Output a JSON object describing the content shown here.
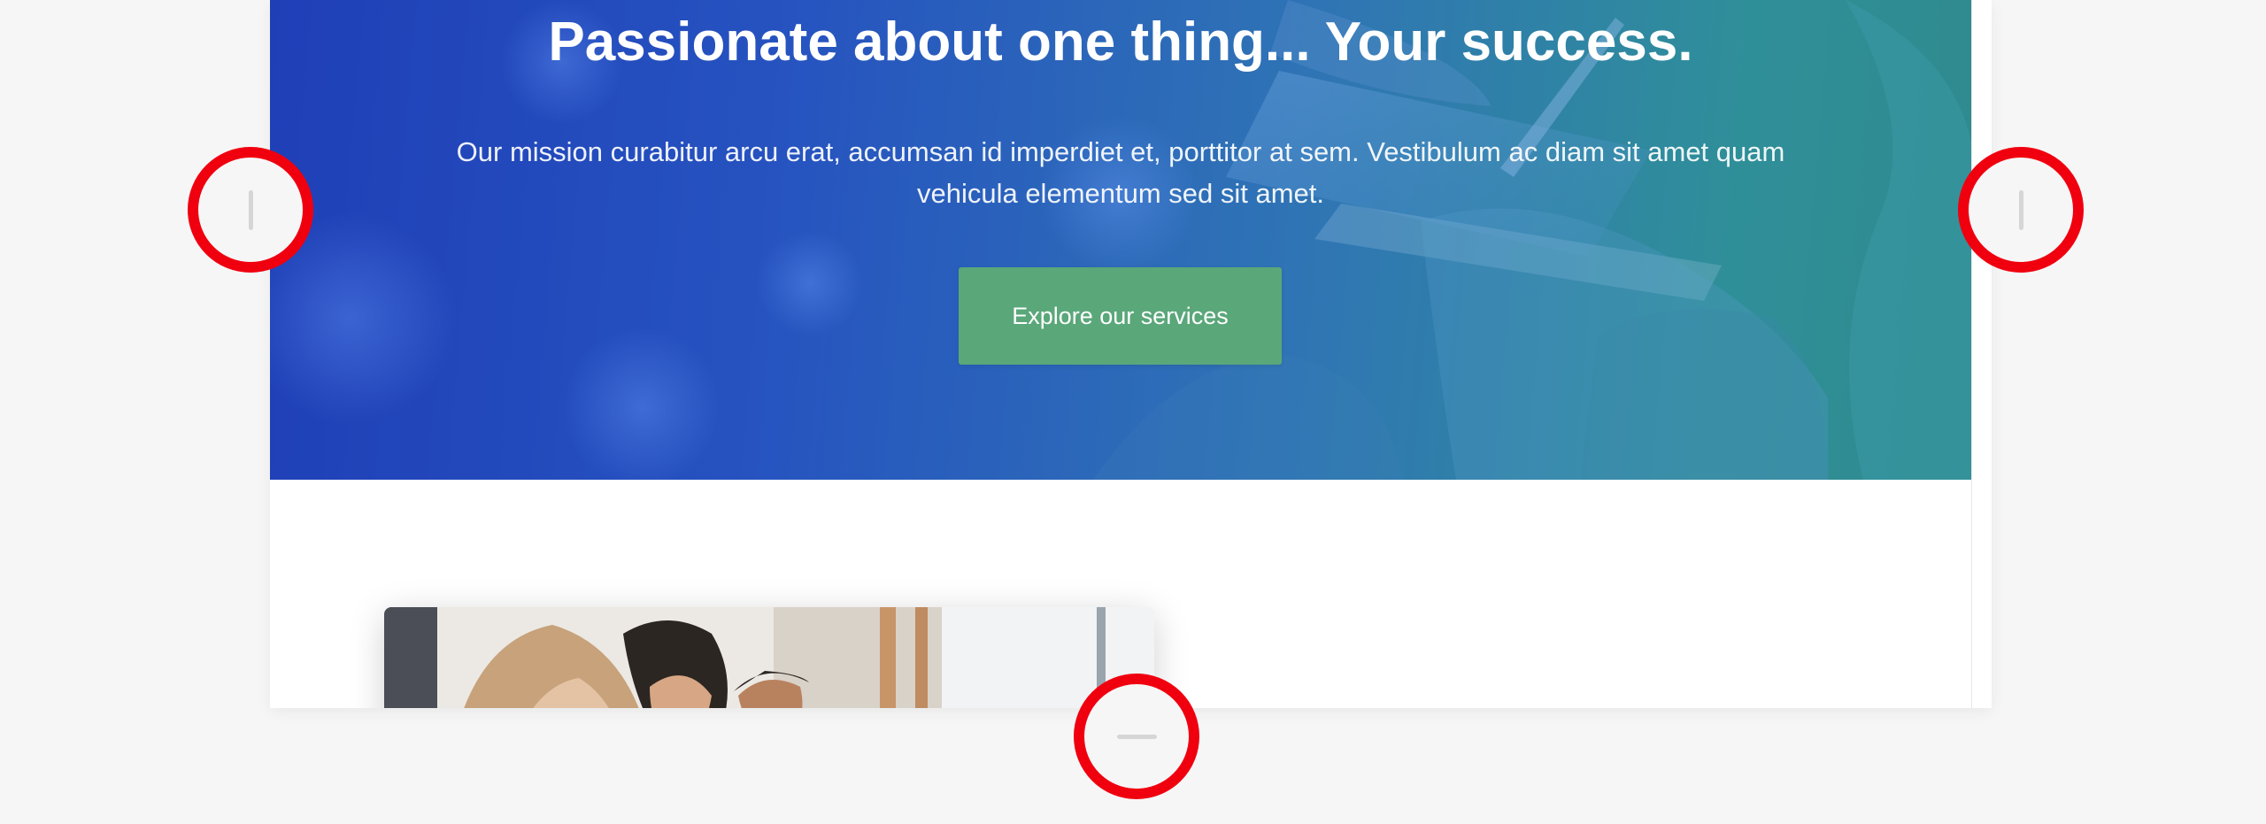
{
  "hero": {
    "title": "Passionate about one thing... Your success.",
    "subtitle": "Our mission curabitur arcu erat, accumsan id imperdiet et, porttitor at sem. Vestibulum ac diam sit amet quam vehicula elementum sed sit amet.",
    "cta_label": "Explore our services"
  },
  "colors": {
    "hero_gradient_start": "#1f3fb7",
    "hero_gradient_end": "#2f8a8d",
    "cta_background": "#5aa77a",
    "handle_ring": "#f0000f",
    "page_background": "#f6f6f6"
  },
  "icons": {
    "handle_left": "vertical-grip-icon",
    "handle_right": "vertical-grip-icon",
    "handle_bottom": "horizontal-grip-icon"
  }
}
